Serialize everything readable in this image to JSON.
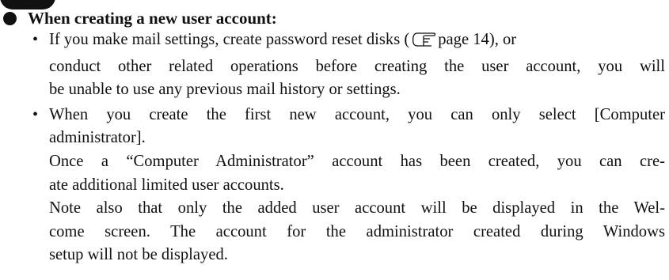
{
  "heading": "When creating a new user account:",
  "item1": {
    "part1": "If you make mail settings, create password reset disks (",
    "page_ref": "page 14), or",
    "line2": "conduct other related operations before creating the user account, you will",
    "line3": "be unable to use any previous mail history or settings."
  },
  "item2": {
    "line1": "When you create the first new account, you can only select [Computer",
    "line2": "administrator].",
    "line3": "Once a “Computer Administrator” account has been created, you can cre-",
    "line4": "ate additional limited user accounts.",
    "line5": "Note also that only the added user account will be displayed in the Wel-",
    "line6": "come screen. The account for the administrator created during Windows",
    "line7": "setup will not be displayed."
  },
  "icons": {
    "reference": "pointing-hand-icon",
    "bullet": "•"
  }
}
